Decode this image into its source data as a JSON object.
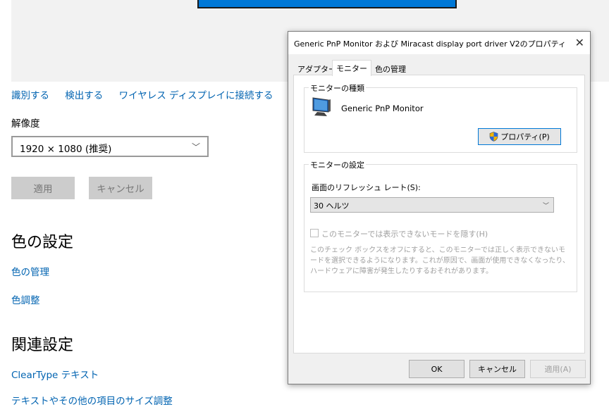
{
  "settings": {
    "links": [
      "識別する",
      "検出する",
      "ワイヤレス ディスプレイに接続する"
    ],
    "resolution_label": "解像度",
    "resolution_value": "1920 × 1080 (推奨)",
    "apply_label": "適用",
    "cancel_label": "キャンセル",
    "color_heading": "色の設定",
    "color_management_link": "色の管理",
    "color_calibration_link": "色調整",
    "related_heading": "関連設定",
    "cleartype_link": "ClearType テキスト",
    "text_size_link": "テキストやその他の項目のサイズ調整"
  },
  "dialog": {
    "title": "Generic PnP Monitor および Miracast display port driver V2のプロパティ",
    "close_glyph": "✕",
    "tabs": [
      "アダプター",
      "モニター",
      "色の管理"
    ],
    "monitor_type_group": "モニターの種類",
    "monitor_name": "Generic PnP Monitor",
    "properties_button": "プロパティ(P)",
    "monitor_settings_group": "モニターの設定",
    "refresh_rate_label": "画面のリフレッシュ レート(S):",
    "refresh_rate_value": "30 ヘルツ",
    "hide_modes_label": "このモニターでは表示できないモードを隠す(H)",
    "hide_modes_description": "このチェック ボックスをオフにすると、このモニターでは正しく表示できないモードを選択できるようになります。これが原因で、画面が使用できなくなったり、ハードウェアに障害が発生したりするおそれがあります。",
    "ok_button": "OK",
    "cancel_button": "キャンセル",
    "apply_button": "適用(A)"
  },
  "colors": {
    "accent": "#0078d7",
    "link": "#0063b1"
  },
  "icons": [
    "monitor-icon",
    "uac-shield-icon",
    "chevron-down-icon",
    "close-icon"
  ]
}
